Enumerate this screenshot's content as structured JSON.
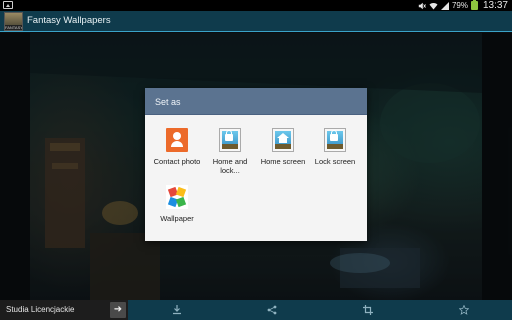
{
  "status_bar": {
    "battery_percent": "79%",
    "time": "13:37",
    "icons": [
      "image-icon",
      "mute-icon",
      "wifi-icon",
      "signal-icon",
      "battery-icon"
    ]
  },
  "app_bar": {
    "icon_label": "FANTASY",
    "title": "Fantasy Wallpapers"
  },
  "dialog": {
    "title": "Set as",
    "options": [
      {
        "label": "Contact photo",
        "icon": "contact-photo-icon"
      },
      {
        "label": "Home and lock...",
        "icon": "home-and-lock-icon"
      },
      {
        "label": "Home screen",
        "icon": "home-screen-icon"
      },
      {
        "label": "Lock screen",
        "icon": "lock-screen-icon"
      },
      {
        "label": "Wallpaper",
        "icon": "wallpaper-icon"
      }
    ]
  },
  "bottom_bar": {
    "promo_text": "Studia Licencjackie",
    "promo_arrow_icon": "arrow-right-icon",
    "actions": [
      {
        "icon": "download-icon"
      },
      {
        "icon": "share-icon"
      },
      {
        "icon": "crop-icon"
      },
      {
        "icon": "star-icon"
      }
    ]
  },
  "colors": {
    "app_bar": "#0f3b4c",
    "accent_line": "#3aa3c8",
    "dialog_header": "#5b7390",
    "dialog_body": "#f4f4f4"
  }
}
